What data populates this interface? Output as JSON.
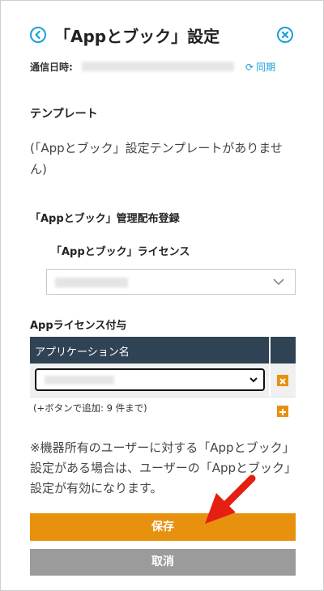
{
  "header": {
    "title": "「Appとブック」設定"
  },
  "sync": {
    "label": "通信日時:",
    "value": "",
    "action_label": "同期"
  },
  "template": {
    "heading": "テンプレート",
    "empty_message": "(「Appとブック」設定テンプレートがありません)"
  },
  "mdm": {
    "heading": "「Appとブック」管理配布登録",
    "license_label": "「Appとブック」ライセンス",
    "license_value": ""
  },
  "assignment": {
    "heading": "Appライセンス付与",
    "column_header": "アプリケーション名",
    "rows": [
      {
        "app_value": ""
      }
    ],
    "add_hint": "(+ボタンで追加: 9 件まで)"
  },
  "note": "※機器所有のユーザーに対する「Appとブック」設定がある場合は、ユーザーの「Appとブック」設定が有効になります。",
  "actions": {
    "save_label": "保存",
    "cancel_label": "取消"
  },
  "colors": {
    "accent": "#1aa0d8",
    "primary_button": "#e8910f",
    "secondary_button": "#9b9b9b",
    "table_header": "#2f4354",
    "annotation_arrow": "#e41f13"
  },
  "icons": {
    "back": "chevron-left-circle-icon",
    "close": "close-circle-icon",
    "sync": "refresh-icon",
    "dropdown": "chevron-down-icon",
    "delete": "close-square-icon",
    "add": "plus-square-icon",
    "annotation": "red-arrow-icon"
  }
}
